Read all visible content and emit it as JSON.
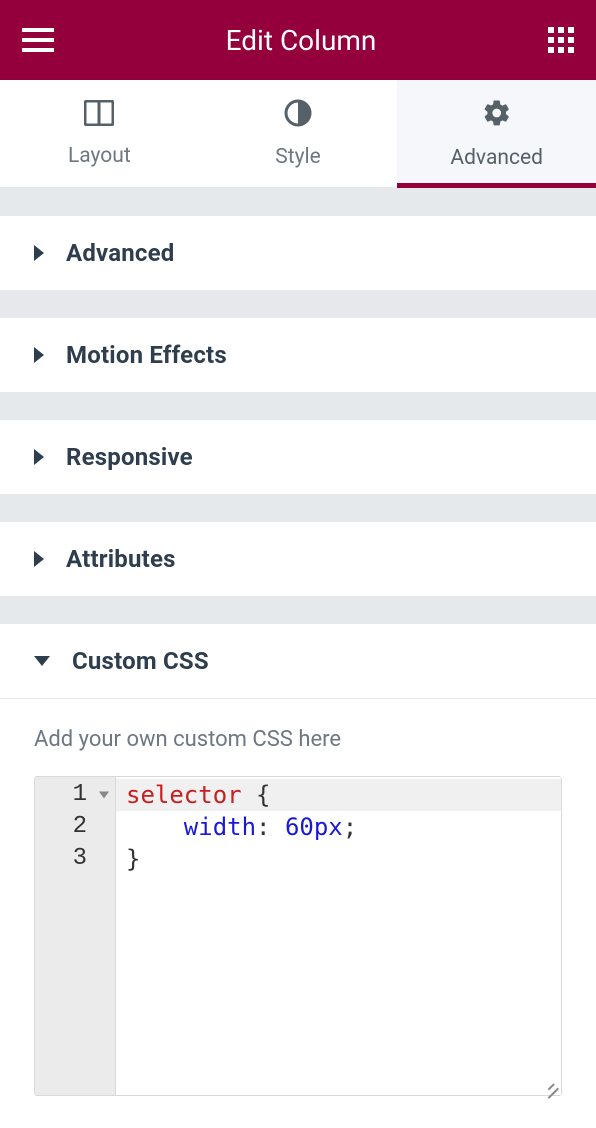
{
  "header": {
    "title": "Edit Column"
  },
  "tabs": {
    "layout": {
      "label": "Layout"
    },
    "style": {
      "label": "Style"
    },
    "advanced": {
      "label": "Advanced"
    }
  },
  "sections": {
    "advanced": {
      "label": "Advanced"
    },
    "motion_effects": {
      "label": "Motion Effects"
    },
    "responsive": {
      "label": "Responsive"
    },
    "attributes": {
      "label": "Attributes"
    },
    "custom_css": {
      "label": "Custom CSS"
    }
  },
  "custom_css_panel": {
    "description": "Add your own custom CSS here",
    "gutter_lines": [
      "1",
      "2",
      "3"
    ],
    "code": {
      "line1_sel": "selector",
      "line1_brace": " {",
      "line2_indent": "    ",
      "line2_prop": "width",
      "line2_colon": ": ",
      "line2_val": "60px",
      "line2_semi": ";",
      "line3_brace": "}"
    }
  }
}
